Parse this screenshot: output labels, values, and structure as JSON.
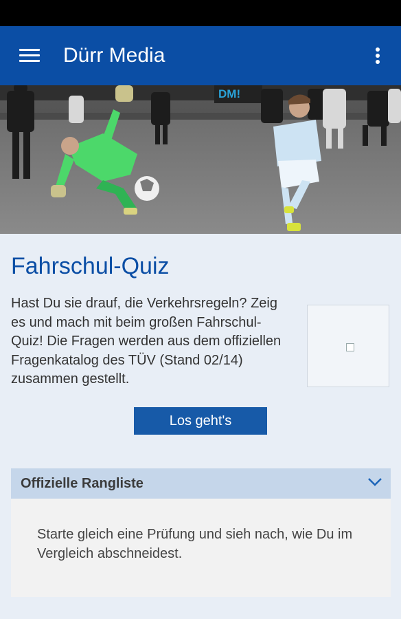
{
  "app_bar": {
    "title": "Dürr Media",
    "menu_icon": "hamburger-menu-icon",
    "overflow_icon": "more-vert-icon"
  },
  "hero": {
    "banner_text": "DM!"
  },
  "quiz": {
    "title": "Fahrschul-Quiz",
    "description": "Hast Du sie drauf, die Verkehrsregeln? Zeig es und mach mit beim großen Fahrschul-Quiz! Die Fragen werden aus dem offiziellen Fragenkatalog des TÜV (Stand 02/14) zusammen gestellt.",
    "start_label": "Los geht's"
  },
  "ranking": {
    "title": "Offizielle Rangliste",
    "text": "Starte gleich eine Prüfung und sieh nach, wie Du im Vergleich abschneidest."
  },
  "colors": {
    "primary": "#0b4ea5",
    "button": "#175aa8",
    "accordion_header": "#c5d6ea"
  }
}
